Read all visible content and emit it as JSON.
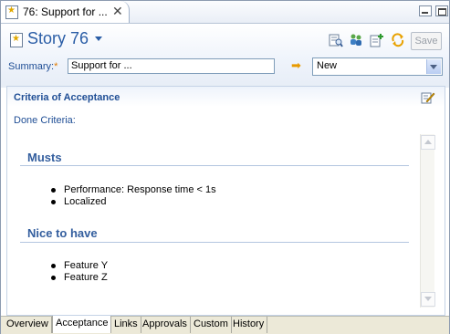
{
  "editor_tab": {
    "label": "76: Support for ...",
    "close": "✕"
  },
  "header": {
    "title": "Story 76",
    "save_label": "Save",
    "summary_label": "Summary:",
    "summary_required": "*",
    "summary_value": "Support for ...",
    "status_value": "New"
  },
  "section": {
    "title": "Criteria of Acceptance",
    "done_label": "Done Criteria:"
  },
  "criteria": {
    "musts_heading": "Musts",
    "musts": [
      "Performance: Response time < 1s",
      "Localized"
    ],
    "nice_heading": "Nice to have",
    "nice": [
      "Feature Y",
      "Feature Z"
    ]
  },
  "bottom_tabs": [
    "Overview",
    "Acceptance",
    "Links",
    "Approvals",
    "Custom",
    "History"
  ],
  "active_bottom_tab": "Acceptance",
  "colors": {
    "heading_blue": "#1f4e95",
    "title_blue": "#2a5da6",
    "accent_orange": "#e89a00"
  }
}
